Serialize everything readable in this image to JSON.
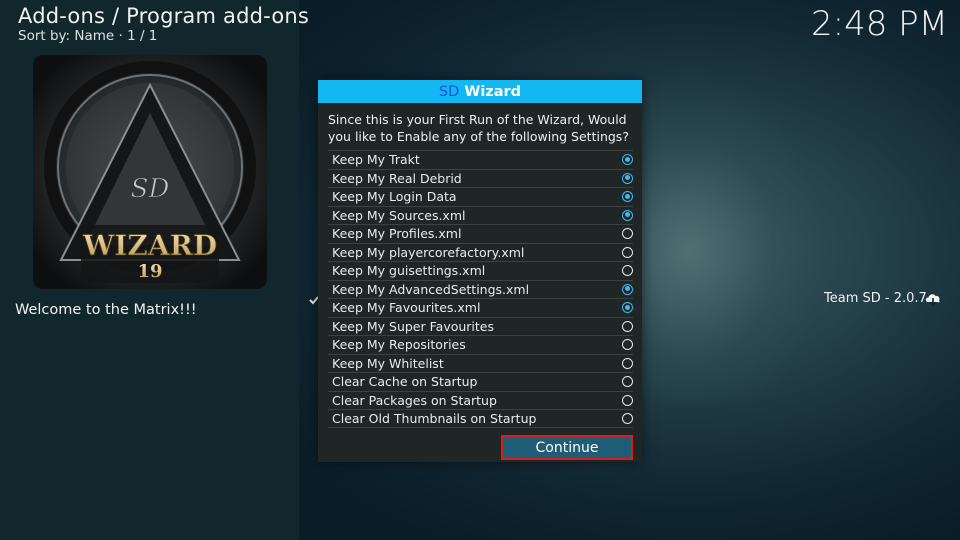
{
  "header": {
    "breadcrumb": "Add-ons / Program add-ons",
    "sort_info": "Sort by: Name  ·  1 / 1",
    "clock": "2:48 PM"
  },
  "addon": {
    "art_text_sd": "SD",
    "art_text_name": "WIZARD",
    "art_text_version": "19",
    "description": "Welcome to the Matrix!!!",
    "author_version": "Team SD - 2.0.7"
  },
  "dialog": {
    "title_sd": "SD",
    "title_wizard": " Wizard",
    "prompt": "Since this is your First Run of the Wizard, Would you like to Enable any of the following Settings?",
    "options": [
      {
        "label": "Keep My Trakt",
        "checked": true
      },
      {
        "label": "Keep My Real Debrid",
        "checked": true
      },
      {
        "label": "Keep My Login Data",
        "checked": true
      },
      {
        "label": "Keep My Sources.xml",
        "checked": true
      },
      {
        "label": "Keep My Profiles.xml",
        "checked": false
      },
      {
        "label": "Keep My playercorefactory.xml",
        "checked": false
      },
      {
        "label": "Keep My guisettings.xml",
        "checked": false
      },
      {
        "label": "Keep My AdvancedSettings.xml",
        "checked": true
      },
      {
        "label": "Keep My Favourites.xml",
        "checked": true
      },
      {
        "label": "Keep My Super Favourites",
        "checked": false
      },
      {
        "label": "Keep My Repositories",
        "checked": false
      },
      {
        "label": "Keep My Whitelist",
        "checked": false
      },
      {
        "label": "Clear Cache on Startup",
        "checked": false
      },
      {
        "label": "Clear Packages on Startup",
        "checked": false
      },
      {
        "label": "Clear Old Thumbnails on Startup",
        "checked": false
      }
    ],
    "continue_label": "Continue"
  },
  "colors": {
    "accent": "#13b7f2",
    "radio_on": "#3db9f0",
    "focus_border": "#d81e1e",
    "button_bg": "#1f5d76"
  }
}
